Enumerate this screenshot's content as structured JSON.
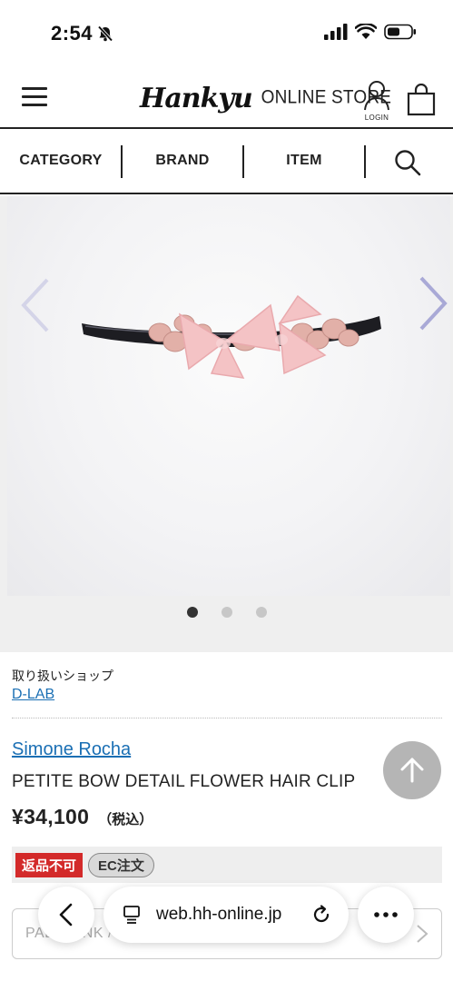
{
  "status_bar": {
    "time": "2:54"
  },
  "header": {
    "logo_script": "Hankyu",
    "logo_sub": "ONLINE STORE",
    "login_label": "LOGIN"
  },
  "nav": {
    "items": [
      {
        "label": "CATEGORY"
      },
      {
        "label": "BRAND"
      },
      {
        "label": "ITEM"
      }
    ]
  },
  "carousel": {
    "slide_count": 3,
    "active_index": 0
  },
  "product": {
    "shop_label": "取り扱いショップ",
    "shop_name": "D-LAB",
    "brand": "Simone Rocha",
    "name": "PETITE BOW DETAIL FLOWER HAIR CLIP",
    "price": "¥34,100",
    "tax_note": "（税込）",
    "badges": [
      "返品不可",
      "EC注文"
    ],
    "option_text": "PALE PINK / -"
  },
  "browser": {
    "url": "web.hh-online.jp"
  },
  "colors": {
    "link": "#1a6fb4",
    "badge_red": "#d32a2a",
    "carousel_arrow": "#a9a9d6"
  }
}
